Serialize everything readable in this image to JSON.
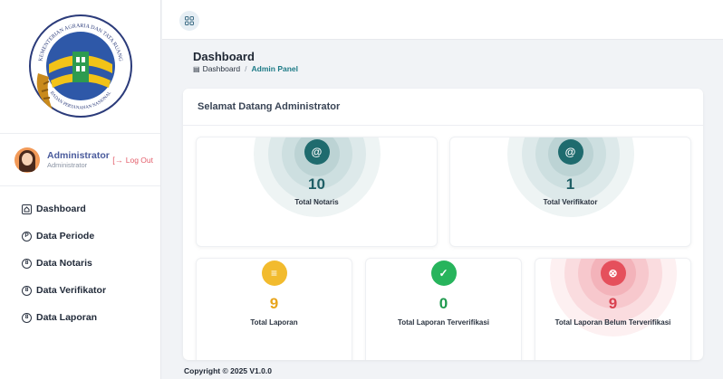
{
  "sidebar": {
    "logo_top_text": "KEMENTERIAN AGRARIA DAN TATA RUANG",
    "logo_bottom_text": "BADAN PERTANAHAN NASIONAL",
    "user": {
      "name": "Administrator",
      "role": "Administrator",
      "logout_label": "Log Out"
    },
    "menu": [
      {
        "label": "Dashboard",
        "icon": "home-icon",
        "glyph": ""
      },
      {
        "label": "Data Periode",
        "icon": "p-circle-icon",
        "glyph": "P"
      },
      {
        "label": "Data Notaris",
        "icon": "user-circle-icon",
        "glyph": "8"
      },
      {
        "label": "Data Verifikator",
        "icon": "user-circle-icon",
        "glyph": "8"
      },
      {
        "label": "Data Laporan",
        "icon": "user-circle-icon",
        "glyph": "8"
      }
    ]
  },
  "topbar": {
    "menu_icon": "grid-icon"
  },
  "header": {
    "title": "Dashboard",
    "breadcrumb": {
      "home_icon": "dashboard-icon",
      "home": "Dashboard",
      "separator": "/",
      "current": "Admin Panel"
    }
  },
  "main": {
    "welcome": "Selamat Datang Administrator",
    "stats": [
      {
        "value": "10",
        "label": "Total Notaris",
        "icon": "user-check-icon",
        "glyph": "@",
        "color": "#1f6b6e",
        "ring": "#c9dcdd"
      },
      {
        "value": "1",
        "label": "Total Verifikator",
        "icon": "user-check-icon",
        "glyph": "@",
        "color": "#1f6b6e",
        "ring": "#c9dcdd"
      },
      {
        "value": "9",
        "label": "Total Laporan",
        "icon": "report-icon",
        "glyph": "≡",
        "color": "#f2bb2e",
        "ring": "#fbeec6"
      },
      {
        "value": "0",
        "label": "Total Laporan Terverifikasi",
        "icon": "check-icon",
        "glyph": "✓",
        "color": "#27b45c",
        "ring": "#d1f0dc"
      },
      {
        "value": "9",
        "label": "Total Laporan Belum Terverifikasi",
        "icon": "x-circle-icon",
        "glyph": "⊗",
        "color": "#e5505c",
        "ring": "#f9cdd1"
      }
    ]
  },
  "footer": {
    "copyright": "Copyright © 2025 V1.0.0"
  }
}
